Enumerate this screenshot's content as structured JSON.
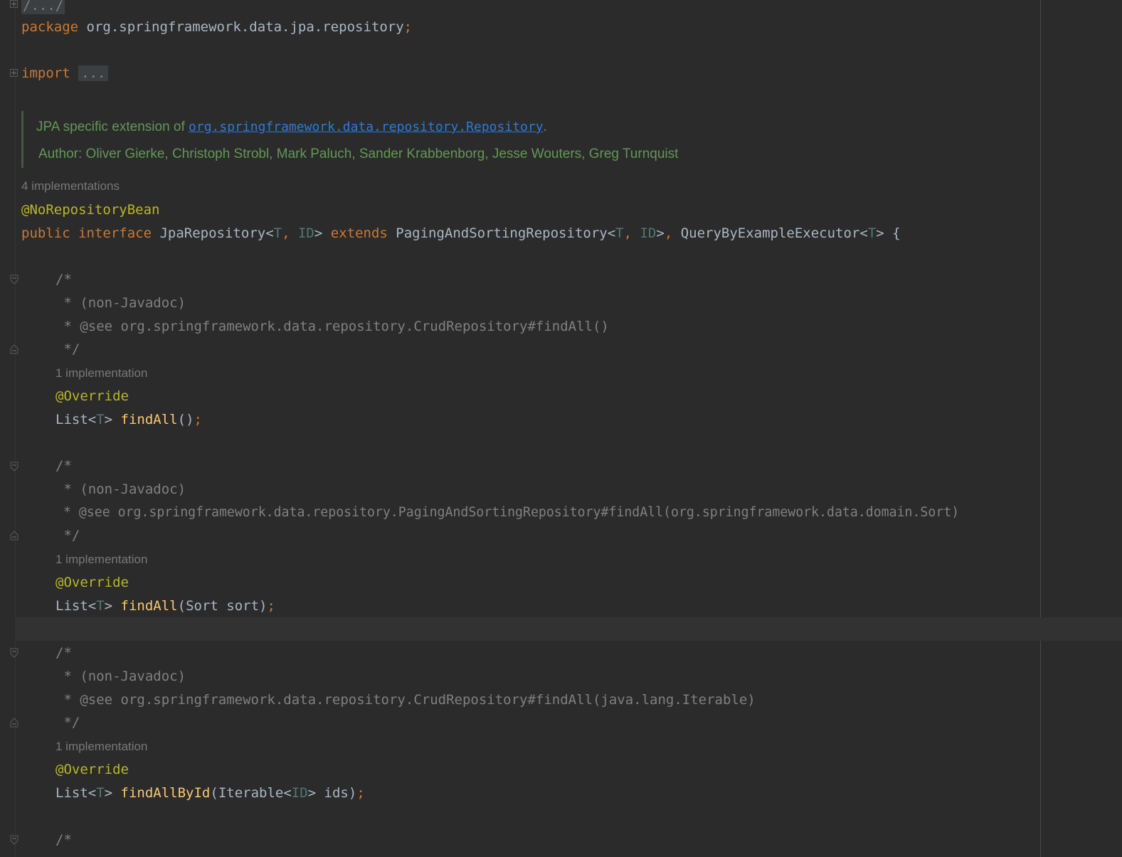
{
  "editor": {
    "header_fold": "/.../",
    "package_kw": "package",
    "package_name": " org.springframework.data.jpa.repository",
    "semicolon": ";",
    "import_kw": "import",
    "import_fold": "...",
    "doc": {
      "prefix": "JPA specific extension of ",
      "link": "org.springframework.data.repository.Repository",
      "suffix": ".",
      "author": "Author: Oliver Gierke, Christoph Strobl, Mark Paluch, Sander Krabbenborg, Jesse Wouters, Greg Turnquist"
    },
    "interface_hint": "4 implementations",
    "class_annotation": "@NoRepositoryBean",
    "decl": {
      "public": "public",
      "interface": "interface",
      "name": " JpaRepository<",
      "t": "T",
      "comma": ",",
      "id": " ID",
      "close1": "> ",
      "extends": "extends",
      "parent1": " PagingAndSortingRepository<",
      "close2": ">",
      "parent2": " QueryByExampleExecutor<",
      "close3": "> {"
    },
    "methods": [
      {
        "c_open": "/*",
        "c_line1": " * (non-Javadoc)",
        "c_line2": " * @see org.springframework.data.repository.CrudRepository#findAll()",
        "c_close": " */",
        "hint": "1 implementation",
        "annotation": "@Override",
        "ret": "List<",
        "t": "T",
        "ret_close": "> ",
        "name": "findAll",
        "params": "()",
        "semi": ";"
      },
      {
        "c_open": "/*",
        "c_line1": " * (non-Javadoc)",
        "c_line2": " * @see org.springframework.data.repository.PagingAndSortingRepository#findAll(org.springframework.data.domain.Sort)",
        "c_close": " */",
        "hint": "1 implementation",
        "annotation": "@Override",
        "ret": "List<",
        "t": "T",
        "ret_close": "> ",
        "name": "findAll",
        "params": "(Sort sort)",
        "semi": ";"
      },
      {
        "c_open": "/*",
        "c_line1": " * (non-Javadoc)",
        "c_line2": " * @see org.springframework.data.repository.CrudRepository#findAll(java.lang.Iterable)",
        "c_close": " */",
        "hint": "1 implementation",
        "annotation": "@Override",
        "ret": "List<",
        "t": "T",
        "ret_close": "> ",
        "name": "findAllById",
        "params_a": "(Iterable<",
        "id": "ID",
        "params_b": "> ids)",
        "semi": ";"
      }
    ],
    "trailing_comment": "/*"
  }
}
